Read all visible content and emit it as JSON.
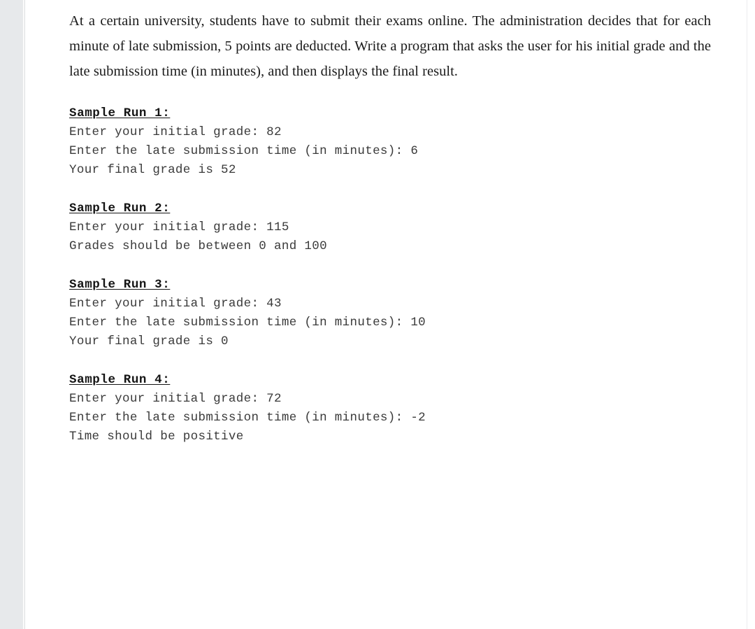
{
  "document": {
    "problem_statement": "At a certain university, students have to submit their exams online. The administration decides that for each minute of late submission, 5 points are deducted. Write a program that asks the user for his initial grade and the late submission time (in minutes), and then displays the final result.",
    "sample_runs": [
      {
        "title": "Sample Run 1:",
        "lines": [
          "Enter your initial grade: 82",
          "Enter the late submission time (in minutes): 6",
          "Your final grade is 52"
        ]
      },
      {
        "title": "Sample Run 2:",
        "lines": [
          "Enter your initial grade: 115",
          "Grades should be between 0 and 100"
        ]
      },
      {
        "title": "Sample Run 3:",
        "lines": [
          "Enter your initial grade: 43",
          "Enter the late submission time (in minutes): 10",
          "Your final grade is 0"
        ]
      },
      {
        "title": "Sample Run 4:",
        "lines": [
          "Enter your initial grade: 72",
          "Enter the late submission time (in minutes): -2",
          "Time should be positive"
        ]
      }
    ]
  },
  "colors": {
    "page_background": "#ffffff",
    "gutter": "#e7e9eb",
    "body_text": "#1a1a1a",
    "mono_text": "#3a3a3a",
    "heading_text": "#141414"
  }
}
